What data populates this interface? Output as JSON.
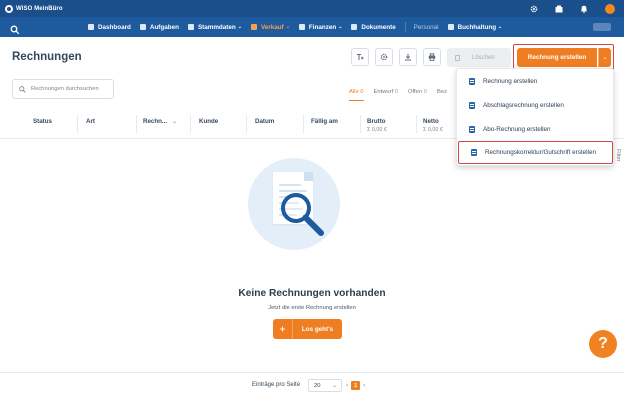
{
  "app": {
    "name": "WISO MeinBüro"
  },
  "topbar": {
    "icons": [
      "gear-icon",
      "files-icon",
      "bell-icon",
      "user-avatar"
    ]
  },
  "nav": {
    "items": [
      {
        "label": "Dashboard",
        "icon": "dashboard-icon",
        "caret": ""
      },
      {
        "label": "Aufgaben",
        "icon": "tasks-icon",
        "caret": ""
      },
      {
        "label": "Stammdaten",
        "icon": "person-icon",
        "caret": "⌄"
      },
      {
        "label": "Verkauf",
        "icon": "cart-icon",
        "caret": "⌄",
        "active": true
      },
      {
        "label": "Finanzen",
        "icon": "finance-icon",
        "caret": "⌄"
      },
      {
        "label": "Dokumente",
        "icon": "document-icon",
        "caret": ""
      },
      {
        "label": "Personal",
        "icon": "",
        "caret": "",
        "muted": true
      },
      {
        "label": "Buchhaltung",
        "icon": "ledger-icon",
        "caret": "⌄"
      }
    ]
  },
  "page": {
    "title": "Rechnungen"
  },
  "toolbar": {
    "delete_label": "Löschen",
    "create_label": "Rechnung erstellen",
    "create_caret": "⌄"
  },
  "search": {
    "placeholder": "Rechnungen durchsuchen"
  },
  "filter_tabs": [
    {
      "label": "Alle",
      "count": "0",
      "active": true
    },
    {
      "label": "Entwurf",
      "count": "0"
    },
    {
      "label": "Offen",
      "count": "0"
    },
    {
      "label": "Bez",
      "count": ""
    }
  ],
  "table": {
    "columns": [
      "Status",
      "Art",
      "Rechn...",
      "Kunde",
      "Datum",
      "Fällig am",
      "Brutto",
      "Netto"
    ],
    "sort_caret": "⌄",
    "brutto_sum": "Σ 0,00 €",
    "netto_sum": "Σ 0,00 €"
  },
  "dropdown": {
    "items": [
      "Rechnung erstellen",
      "Abschlagsrechnung erstellen",
      "Abo-Rechnung erstellen",
      "Rechnungskorrektur/Gutschrift erstellen"
    ]
  },
  "side": {
    "filter_label": "Filter"
  },
  "empty": {
    "title": "Keine Rechnungen vorhanden",
    "subtitle": "Jetzt die erste Rechnung erstellen",
    "button_plus": "+",
    "button_label": "Los geht's"
  },
  "help": {
    "label": "?"
  },
  "footer": {
    "per_page_label": "Einträge pro Seite",
    "per_page_value": "20",
    "per_page_caret": "⌄",
    "prev": "‹",
    "current_page": "1",
    "next": "›"
  },
  "colors": {
    "accent": "#ef7d22",
    "topbar": "#1b4f8c",
    "navbar": "#1e5a9e",
    "highlight": "#d64545"
  }
}
